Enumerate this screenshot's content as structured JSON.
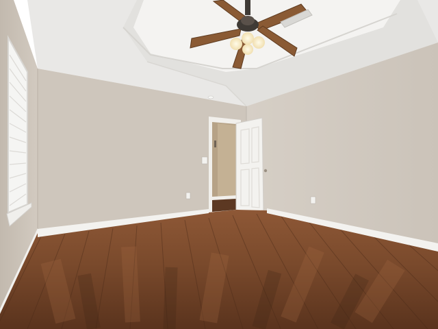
{
  "scene": {
    "subject": "empty-room",
    "colors": {
      "ceiling": "#eeedeb",
      "tray_ceiling": "#f6f5f3",
      "left_wall": "#cfc7bd",
      "back_wall": "#cdc5bb",
      "right_wall": "#d3ccc3",
      "floor_dark": "#4a2a18",
      "floor_mid": "#7a4a2c",
      "floor_light": "#955c38",
      "baseboard": "#f4f3f0",
      "door": "#f2f1ee",
      "hallway": "#b9a58a",
      "fan_blade": "#8a5a34",
      "fan_metal": "#3f3a35",
      "light_glass": "#fff6dc"
    }
  }
}
